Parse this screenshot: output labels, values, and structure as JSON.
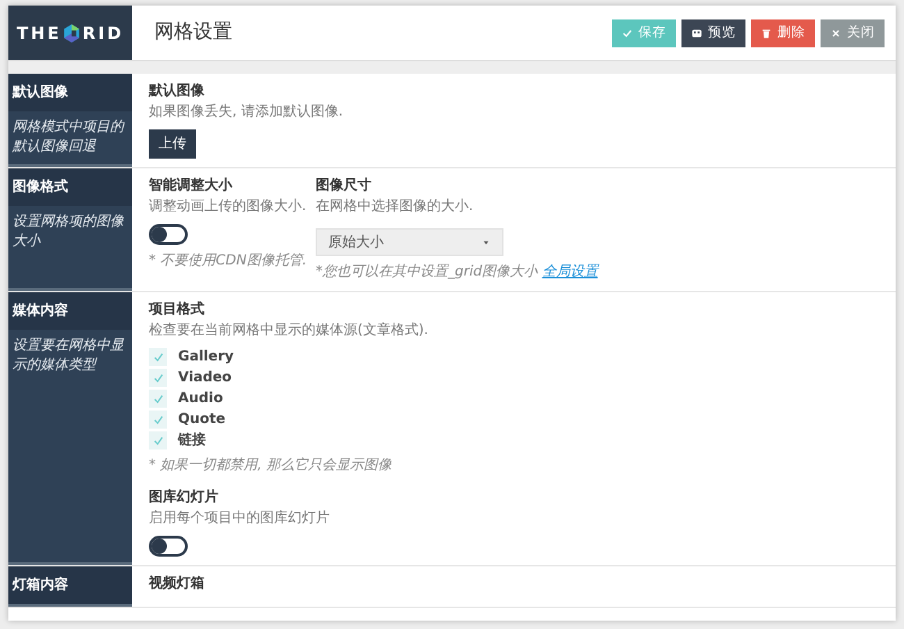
{
  "header": {
    "logo_left": "THE",
    "logo_right": "RID",
    "title": "网格设置",
    "buttons": [
      {
        "label": "保存",
        "kind": "save"
      },
      {
        "label": "预览",
        "kind": "preview"
      },
      {
        "label": "删除",
        "kind": "delete"
      },
      {
        "label": "关闭",
        "kind": "close"
      }
    ]
  },
  "sections": [
    {
      "title": "默认图像",
      "description": "网格模式中项目的默认图像回退",
      "rows": [
        [
          {
            "kind": "upload",
            "title": "默认图像",
            "description": "如果图像丢失, 请添加默认图像.",
            "button": "上传"
          }
        ]
      ]
    },
    {
      "title": "图像格式",
      "description": "设置网格项的图像大小",
      "rows": [
        [
          {
            "kind": "toggle",
            "title": "智能调整大小",
            "description": "调整动画上传的图像大小.",
            "on": false,
            "note": "* 不要使用CDN图像托管."
          },
          {
            "kind": "select",
            "title": "图像尺寸",
            "description": "在网格中选择图像的大小.",
            "value": "原始大小",
            "note": "*您也可以在其中设置_grid图像大小",
            "link": "全局设置"
          }
        ]
      ]
    },
    {
      "title": "媒体内容",
      "description": "设置要在网格中显示的媒体类型",
      "rows": [
        [
          {
            "kind": "checklist",
            "title": "项目格式",
            "description": "检查要在当前网格中显示的媒体源(文章格式).",
            "items": [
              {
                "label": "Gallery",
                "checked": true
              },
              {
                "label": "Viadeo",
                "checked": true
              },
              {
                "label": "Audio",
                "checked": true
              },
              {
                "label": "Quote",
                "checked": true
              },
              {
                "label": "链接",
                "checked": true
              }
            ],
            "note": "* 如果一切都禁用, 那么它只会显示图像"
          }
        ],
        [
          {
            "kind": "toggle",
            "title": "图库幻灯片",
            "description": "启用每个项目中的图库幻灯片",
            "on": false
          }
        ]
      ]
    },
    {
      "title": "灯箱内容",
      "rows": [
        [
          {
            "kind": "heading",
            "title": "视频灯箱"
          }
        ]
      ]
    }
  ]
}
